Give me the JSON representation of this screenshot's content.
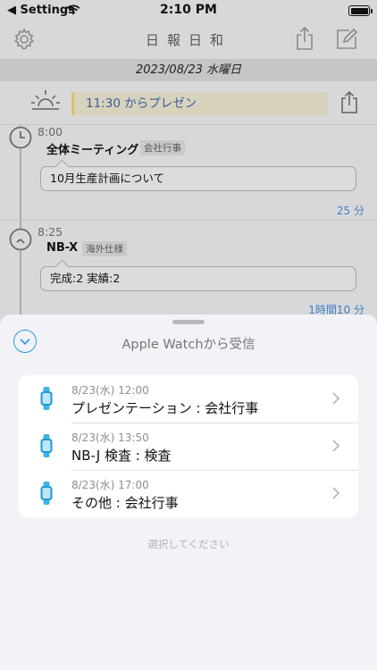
{
  "status_bar": {
    "back_label": "◀ Settings",
    "time": "2:10 PM"
  },
  "nav": {
    "title": "日報日和"
  },
  "date_bar": {
    "date": "2023/08/23 水曜日"
  },
  "memo": {
    "text": "11:30 からプレゼン"
  },
  "entries": [
    {
      "time": "8:00",
      "title": "全体ミーティング",
      "tag": "会社行事",
      "note": "10月生産計画について",
      "duration": "25 分"
    },
    {
      "time": "8:25",
      "title": "NB-X",
      "tag": "海外仕様",
      "note": "完成:2 実績:2",
      "duration": "1時間10 分"
    }
  ],
  "sheet": {
    "title": "Apple Watchから受信",
    "items": [
      {
        "date": "8/23(水) 12:00",
        "title": "プレゼンテーション : 会社行事"
      },
      {
        "date": "8/23(水) 13:50",
        "title": "NB-J 検査 : 検査"
      },
      {
        "date": "8/23(水) 17:00",
        "title": "その他 : 会社行事"
      }
    ],
    "hint": "選択してください"
  },
  "colors": {
    "accent": "#2c9ddc",
    "link": "#3f7fc2",
    "memo_bg": "#d6d2bc"
  },
  "icons": [
    "wifi-icon",
    "battery-icon",
    "gear-icon",
    "share-icon",
    "compose-icon",
    "sunrise-icon",
    "clock-icon",
    "chevron-down-icon",
    "watch-icon",
    "chevron-right-icon"
  ]
}
